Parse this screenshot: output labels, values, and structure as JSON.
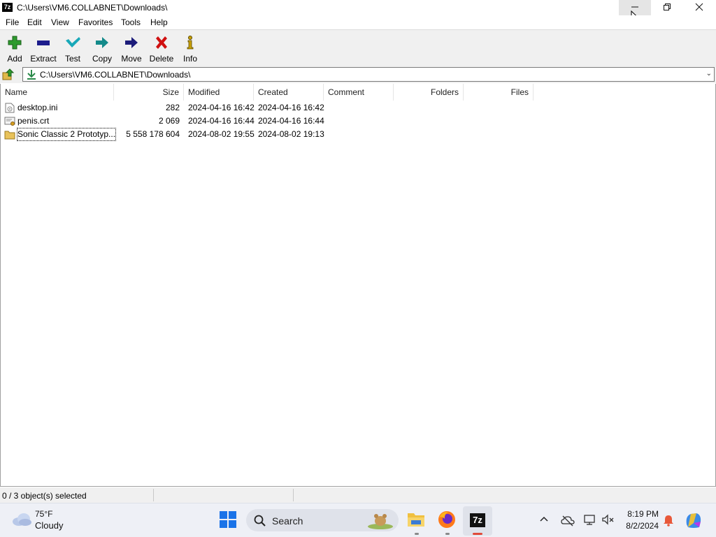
{
  "window": {
    "title": "C:\\Users\\VM6.COLLABNET\\Downloads\\",
    "app_icon_text": "7z",
    "controls": {
      "minimize": "minimize",
      "maximize": "restore",
      "close": "close"
    }
  },
  "menu": [
    "File",
    "Edit",
    "View",
    "Favorites",
    "Tools",
    "Help"
  ],
  "toolbar": {
    "add": "Add",
    "extract": "Extract",
    "test": "Test",
    "copy": "Copy",
    "move": "Move",
    "delete": "Delete",
    "info": "Info"
  },
  "address": {
    "path": "C:\\Users\\VM6.COLLABNET\\Downloads\\"
  },
  "columns": {
    "name": "Name",
    "size": "Size",
    "modified": "Modified",
    "created": "Created",
    "comment": "Comment",
    "folders": "Folders",
    "files": "Files"
  },
  "files": [
    {
      "name": "desktop.ini",
      "size": "282",
      "modified": "2024-04-16 16:42",
      "created": "2024-04-16 16:42",
      "icon": "ini-file-icon"
    },
    {
      "name": "penis.crt",
      "size": "2 069",
      "modified": "2024-04-16 16:44",
      "created": "2024-04-16 16:44",
      "icon": "certificate-file-icon"
    },
    {
      "name": "Sonic Classic 2 Prototyp...",
      "size": "5 558 178 604",
      "modified": "2024-08-02 19:55",
      "created": "2024-08-02 19:13",
      "icon": "folder-icon"
    }
  ],
  "status": {
    "selection": "0 / 3 object(s) selected"
  },
  "taskbar": {
    "weather_temp": "75°F",
    "weather_cond": "Cloudy",
    "search_label": "Search",
    "time": "8:19 PM",
    "date": "8/2/2024",
    "taskbar_7zip_text": "7z"
  },
  "colors": {
    "add": "#2e9a2e",
    "extract": "#1c1c8c",
    "test": "#18a8b8",
    "copy": "#138a8a",
    "move": "#1c1c7a",
    "delete": "#d01010",
    "info": "#c8a000"
  }
}
